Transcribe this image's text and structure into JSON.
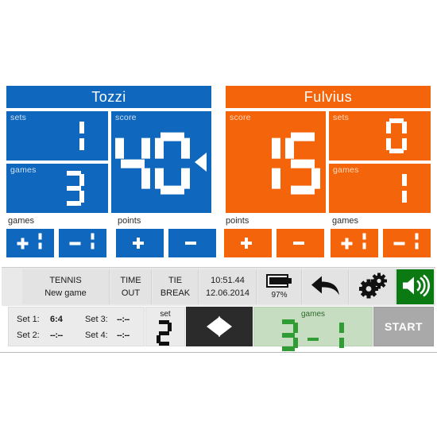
{
  "players": {
    "left": {
      "name": "Tozzi",
      "color": "#0f68bd",
      "sets_label": "sets",
      "sets_value": "1",
      "games_label": "games",
      "games_value": "3",
      "score_label": "score",
      "score_value": "40",
      "serving": true,
      "adjust": {
        "games_label": "games",
        "games_plus": "+1",
        "games_minus": "-1",
        "points_label": "points",
        "points_plus": "+",
        "points_minus": "-"
      }
    },
    "right": {
      "name": "Fulvius",
      "color": "#f4650b",
      "sets_label": "sets",
      "sets_value": "0",
      "games_label": "games",
      "games_value": "1",
      "score_label": "score",
      "score_value": "15",
      "serving": false,
      "adjust": {
        "games_label": "games",
        "games_plus": "+1",
        "games_minus": "-1",
        "points_label": "points",
        "points_plus": "+",
        "points_minus": "-"
      }
    }
  },
  "toolbar": {
    "mode_line1": "TENNIS",
    "mode_line2": "New game",
    "timeout_line1": "TIME",
    "timeout_line2": "OUT",
    "tiebreak_line1": "TIE",
    "tiebreak_line2": "BREAK",
    "clock_time": "10:51.44",
    "clock_date": "12.06.2014",
    "battery_percent": "97%",
    "back_icon": "back-arrow-icon",
    "settings_icon": "gears-icon",
    "sound_icon": "speaker-icon"
  },
  "bottom": {
    "sets": [
      {
        "label": "Set 1:",
        "value": "6:4",
        "empty": false
      },
      {
        "label": "Set 2:",
        "value": "--:--",
        "empty": true
      },
      {
        "label": "Set 3:",
        "value": "--:--",
        "empty": true
      },
      {
        "label": "Set 4:",
        "value": "--:--",
        "empty": true
      }
    ],
    "current_set_label": "set",
    "current_set_value": "2",
    "swap_icon": "swap-arrows-icon",
    "games_total_label": "games",
    "games_total_left": "3",
    "games_total_right": "1",
    "games_total_separator": "-",
    "start_label": "START"
  },
  "colors": {
    "blue": "#0f68bd",
    "orange": "#f4650b",
    "green_button": "#0c7a12",
    "green_score": "#2f9c34",
    "green_panel": "#c7ddc2",
    "dark": "#2b2b2b",
    "gray": "#a9a9a9"
  }
}
